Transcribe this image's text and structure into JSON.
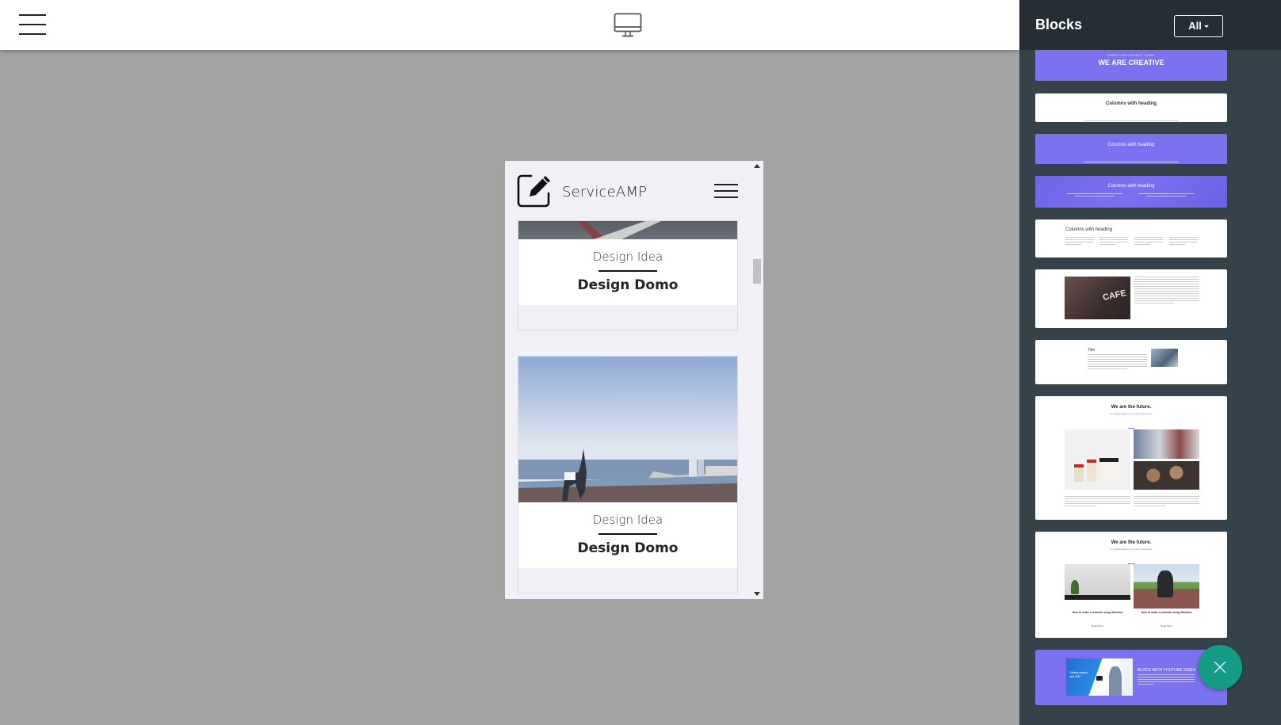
{
  "topbar": {
    "menu_icon": "hamburger-menu-icon",
    "device_icon": "desktop-monitor-icon"
  },
  "preview": {
    "brand": "ServiceAMP",
    "logo_icon": "edit-pencil-square-icon",
    "menu_icon": "hamburger-menu-icon",
    "cards": [
      {
        "subtitle": "Design Idea",
        "title": "Design Domo",
        "image": "notebook-pencil-photo"
      },
      {
        "subtitle": "Design Idea",
        "title": "Design Domo",
        "image": "yoga-rooftop-city-photo"
      }
    ]
  },
  "sidebar": {
    "title": "Blocks",
    "filter_label": "All",
    "blocks": [
      {
        "name": "we-are-creative",
        "kicker": "START YOUR PROJECT TODAY.",
        "heading": "WE ARE CREATIVE",
        "theme": "purple"
      },
      {
        "name": "columns-with-heading-1",
        "heading": "Columns with heading",
        "theme": "white"
      },
      {
        "name": "columns-with-heading-2",
        "heading": "Columns with heading",
        "theme": "purple"
      },
      {
        "name": "columns-with-heading-3",
        "heading": "Columns with heading",
        "theme": "purple-pattern"
      },
      {
        "name": "columns-with-heading-4",
        "heading": "Columns with heading",
        "theme": "white"
      },
      {
        "name": "image-text-cafe",
        "image_label": "CAFE",
        "theme": "white"
      },
      {
        "name": "title-text-image",
        "heading": "Title",
        "theme": "white"
      },
      {
        "name": "we-are-the-future-gallery",
        "heading": "We are the future.",
        "subheading": "a creative agency for smart businesses",
        "theme": "white"
      },
      {
        "name": "we-are-the-future-articles",
        "heading": "We are the future.",
        "subheading": "a creative agency for smart businesses",
        "articles": [
          "How to make a website using Webflow",
          "How to make a website using Webflow"
        ],
        "read_more": "Read More",
        "theme": "white"
      },
      {
        "name": "block-with-youtube-video",
        "heading": "BLOCK WITH YOUTUBE VIDEO",
        "video_text": "Getting started with AMP",
        "theme": "purple"
      }
    ]
  },
  "fab": {
    "icon": "close-x-icon"
  },
  "colors": {
    "accent_purple": "#7b72ef",
    "sidebar_bg": "#36424a",
    "sidebar_header": "#252e35",
    "fab_teal": "#149c86",
    "canvas_gray": "#a3a3a3"
  }
}
